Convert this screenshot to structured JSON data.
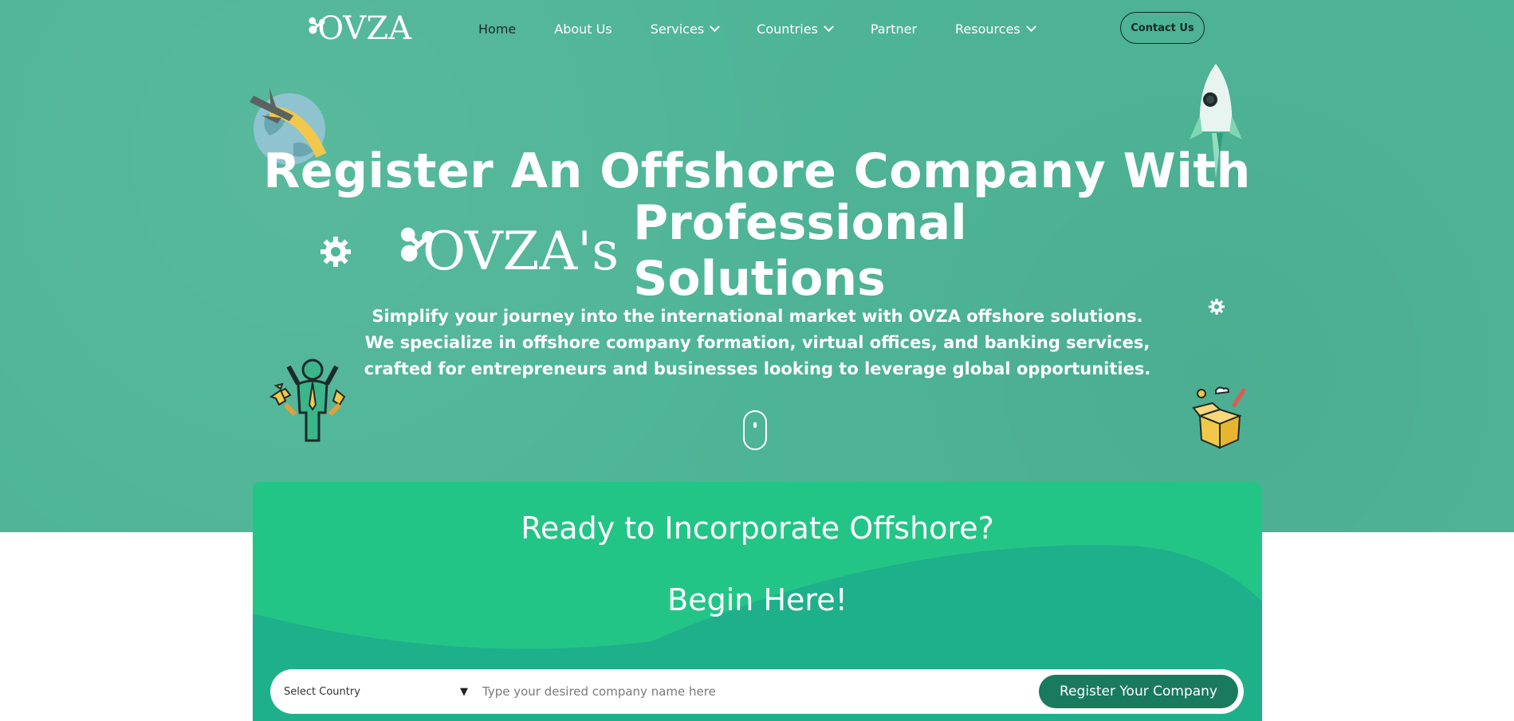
{
  "header": {
    "logo_text": "OVZA",
    "nav": [
      {
        "label": "Home",
        "has_dropdown": false,
        "active": true
      },
      {
        "label": "About Us",
        "has_dropdown": false,
        "active": false
      },
      {
        "label": "Services",
        "has_dropdown": true,
        "active": false
      },
      {
        "label": "Countries",
        "has_dropdown": true,
        "active": false
      },
      {
        "label": "Partner",
        "has_dropdown": false,
        "active": false
      },
      {
        "label": "Resources",
        "has_dropdown": true,
        "active": false
      }
    ],
    "contact_label": "Contact Us"
  },
  "hero": {
    "title_line1": "Register An Offshore Company With",
    "title_brand": "OVZA's",
    "title_line2_rest": "Professional Solutions",
    "subtitle": "Simplify your journey into the international market with OVZA offshore solutions. We specialize in offshore company formation, virtual offices, and banking services, crafted for entrepreneurs and businesses looking to leverage global opportunities.",
    "icons": [
      "globe-plane-icon",
      "rocket-icon",
      "gear-icon",
      "gear-icon",
      "achiever-icon",
      "idea-box-icon",
      "scroll-mouse-icon"
    ]
  },
  "form": {
    "title": "Ready to Incorporate Offshore?",
    "subtitle": "Begin Here!",
    "country_select": "Select Country",
    "company_placeholder": "Type your desired company name here",
    "submit_label": "Register Your Company"
  },
  "colors": {
    "hero_bg": "#4fb597",
    "card_bg": "#23c587",
    "card_wave": "#1eb08a",
    "button_bg": "#1a7a5e"
  }
}
